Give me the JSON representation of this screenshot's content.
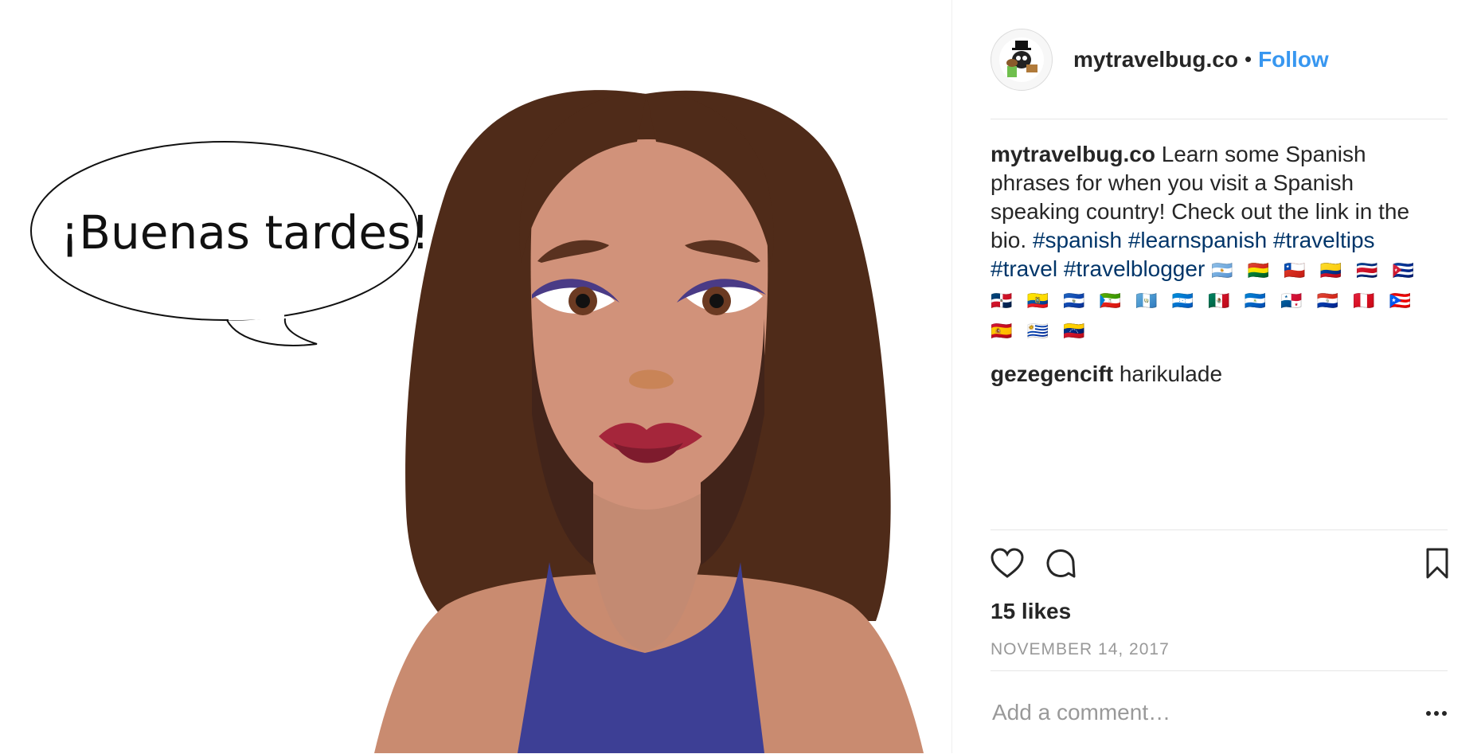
{
  "image": {
    "speech_bubble_text": "¡Buenas tardes!"
  },
  "header": {
    "username": "mytravelbug.co",
    "separator": "•",
    "follow_label": "Follow"
  },
  "caption": {
    "username": "mytravelbug.co",
    "text": "Learn some Spanish phrases for when you visit a Spanish speaking country! Check out the link in the bio.",
    "hashtags": [
      "#spanish",
      "#learnspanish",
      "#traveltips",
      "#travel",
      "#travelblogger"
    ],
    "flags": "🇦🇷 🇧🇴 🇨🇱 🇨🇴 🇨🇷 🇨🇺 🇩🇴 🇪🇨 🇸🇻 🇬🇶 🇬🇹 🇭🇳 🇲🇽 🇳🇮 🇵🇦 🇵🇾 🇵🇪 🇵🇷 🇪🇸 🇺🇾 🇻🇪"
  },
  "comments": [
    {
      "username": "gezegencift",
      "text": "harikulade"
    }
  ],
  "likes": "15 likes",
  "date": "NOVEMBER 14, 2017",
  "add_comment_placeholder": "Add a comment…",
  "colors": {
    "follow": "#3897f0",
    "hashtag": "#003569",
    "hair": "#4f2b19",
    "skin": "#d1927a",
    "shirt": "#3d3f95",
    "lips": "#9b2235"
  },
  "icons": [
    "heart-icon",
    "comment-icon",
    "bookmark-icon",
    "more-options-icon"
  ]
}
